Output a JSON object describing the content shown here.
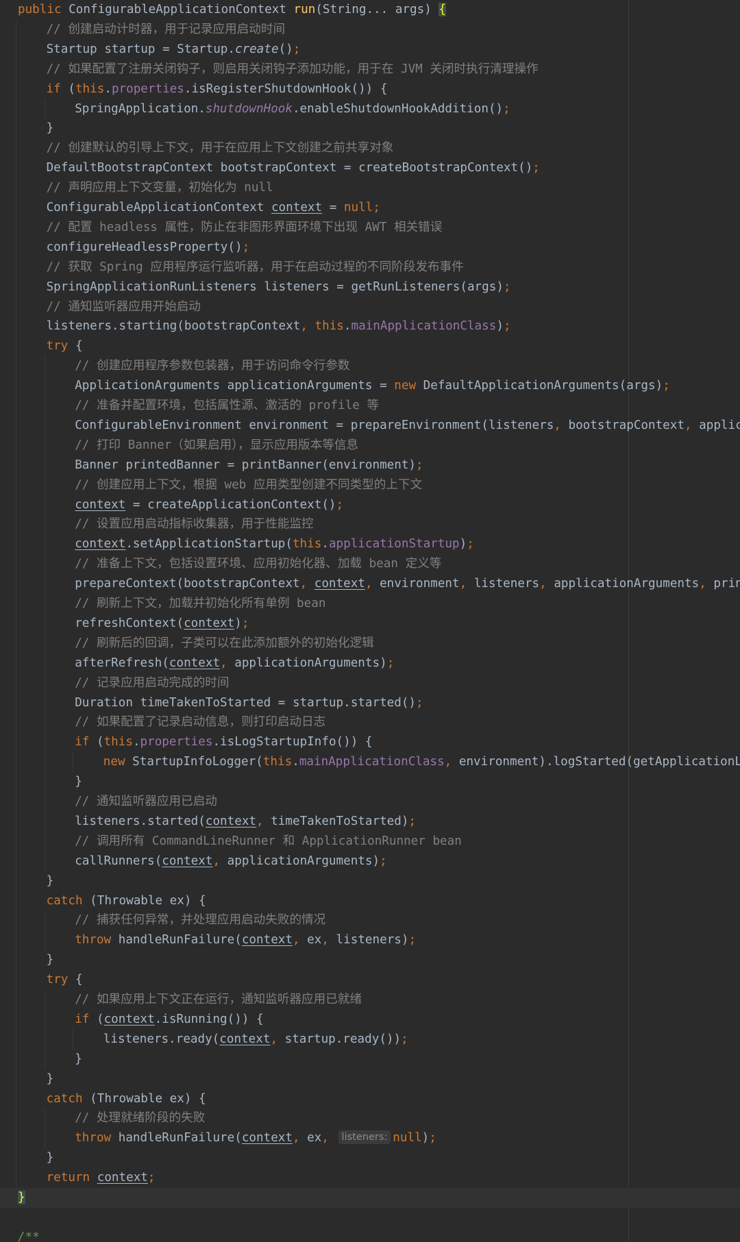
{
  "editor": {
    "language": "Java",
    "colors": {
      "background": "#2b2b2b",
      "default": "#a9b7c6",
      "keyword": "#cc7832",
      "method_declaration": "#ffc66d",
      "comment": "#808080",
      "field": "#9876aa",
      "doc_comment": "#629755",
      "brace_match": "#ffef28"
    },
    "lines": [
      {
        "indent": 0,
        "tokens": [
          {
            "t": "public ",
            "s": "kw"
          },
          {
            "t": "ConfigurableApplicationContext "
          },
          {
            "t": "run",
            "s": "fn"
          },
          {
            "t": "(String... args) "
          },
          {
            "t": "{",
            "s": "brace-hl"
          }
        ]
      },
      {
        "indent": 1,
        "tokens": [
          {
            "t": "// 创建启动计时器，用于记录应用启动时间",
            "s": "cm"
          }
        ]
      },
      {
        "indent": 1,
        "tokens": [
          {
            "t": "Startup startup = Startup."
          },
          {
            "t": "create",
            "s": "ital"
          },
          {
            "t": "()"
          },
          {
            "t": ";",
            "s": "kw"
          }
        ]
      },
      {
        "indent": 1,
        "tokens": [
          {
            "t": "// 如果配置了注册关闭钩子，则启用关闭钩子添加功能，用于在 JVM 关闭时执行清理操作",
            "s": "cm"
          }
        ]
      },
      {
        "indent": 1,
        "tokens": [
          {
            "t": "if ",
            "s": "kw"
          },
          {
            "t": "("
          },
          {
            "t": "this",
            "s": "kw"
          },
          {
            "t": "."
          },
          {
            "t": "properties",
            "s": "fld"
          },
          {
            "t": ".isRegisterShutdownHook()) {"
          }
        ]
      },
      {
        "indent": 2,
        "tokens": [
          {
            "t": "SpringApplication."
          },
          {
            "t": "shutdownHook",
            "s": "st"
          },
          {
            "t": ".enableShutdownHookAddition()"
          },
          {
            "t": ";",
            "s": "kw"
          }
        ]
      },
      {
        "indent": 1,
        "tokens": [
          {
            "t": "}"
          }
        ]
      },
      {
        "indent": 1,
        "tokens": [
          {
            "t": "// 创建默认的引导上下文，用于在应用上下文创建之前共享对象",
            "s": "cm"
          }
        ]
      },
      {
        "indent": 1,
        "tokens": [
          {
            "t": "DefaultBootstrapContext bootstrapContext = createBootstrapContext()"
          },
          {
            "t": ";",
            "s": "kw"
          }
        ]
      },
      {
        "indent": 1,
        "tokens": [
          {
            "t": "// 声明应用上下文变量，初始化为 null",
            "s": "cm"
          }
        ]
      },
      {
        "indent": 1,
        "tokens": [
          {
            "t": "ConfigurableApplicationContext "
          },
          {
            "t": "context",
            "s": "ul"
          },
          {
            "t": " = "
          },
          {
            "t": "null;",
            "s": "kw"
          }
        ]
      },
      {
        "indent": 1,
        "tokens": [
          {
            "t": "// 配置 headless 属性，防止在非图形界面环境下出现 AWT 相关错误",
            "s": "cm"
          }
        ]
      },
      {
        "indent": 1,
        "tokens": [
          {
            "t": "configureHeadlessProperty()"
          },
          {
            "t": ";",
            "s": "kw"
          }
        ]
      },
      {
        "indent": 1,
        "tokens": [
          {
            "t": "// 获取 Spring 应用程序运行监听器，用于在启动过程的不同阶段发布事件",
            "s": "cm"
          }
        ]
      },
      {
        "indent": 1,
        "tokens": [
          {
            "t": "SpringApplicationRunListeners listeners = getRunListeners(args)"
          },
          {
            "t": ";",
            "s": "kw"
          }
        ]
      },
      {
        "indent": 1,
        "tokens": [
          {
            "t": "// 通知监听器应用开始启动",
            "s": "cm"
          }
        ]
      },
      {
        "indent": 1,
        "tokens": [
          {
            "t": "listeners.starting(bootstrapContext"
          },
          {
            "t": ", ",
            "s": "kw"
          },
          {
            "t": "this",
            "s": "kw"
          },
          {
            "t": "."
          },
          {
            "t": "mainApplicationClass",
            "s": "fld"
          },
          {
            "t": ")"
          },
          {
            "t": ";",
            "s": "kw"
          }
        ]
      },
      {
        "indent": 1,
        "tokens": [
          {
            "t": "try ",
            "s": "kw"
          },
          {
            "t": "{"
          }
        ]
      },
      {
        "indent": 2,
        "tokens": [
          {
            "t": "// 创建应用程序参数包装器，用于访问命令行参数",
            "s": "cm"
          }
        ]
      },
      {
        "indent": 2,
        "tokens": [
          {
            "t": "ApplicationArguments applicationArguments = "
          },
          {
            "t": "new ",
            "s": "kw"
          },
          {
            "t": "DefaultApplicationArguments(args)"
          },
          {
            "t": ";",
            "s": "kw"
          }
        ]
      },
      {
        "indent": 2,
        "tokens": [
          {
            "t": "// 准备并配置环境，包括属性源、激活的 profile 等",
            "s": "cm"
          }
        ]
      },
      {
        "indent": 2,
        "tokens": [
          {
            "t": "ConfigurableEnvironment environment = prepareEnvironment(listeners"
          },
          {
            "t": ", ",
            "s": "kw"
          },
          {
            "t": "bootstrapContext"
          },
          {
            "t": ", ",
            "s": "kw"
          },
          {
            "t": "applicat"
          }
        ]
      },
      {
        "indent": 2,
        "tokens": [
          {
            "t": "// 打印 Banner（如果启用），显示应用版本等信息",
            "s": "cm"
          }
        ]
      },
      {
        "indent": 2,
        "tokens": [
          {
            "t": "Banner printedBanner = printBanner(environment)"
          },
          {
            "t": ";",
            "s": "kw"
          }
        ]
      },
      {
        "indent": 2,
        "tokens": [
          {
            "t": "// 创建应用上下文，根据 web 应用类型创建不同类型的上下文",
            "s": "cm"
          }
        ]
      },
      {
        "indent": 2,
        "tokens": [
          {
            "t": "context",
            "s": "ul"
          },
          {
            "t": " = createApplicationContext()"
          },
          {
            "t": ";",
            "s": "kw"
          }
        ]
      },
      {
        "indent": 2,
        "tokens": [
          {
            "t": "// 设置应用启动指标收集器，用于性能监控",
            "s": "cm"
          }
        ]
      },
      {
        "indent": 2,
        "tokens": [
          {
            "t": "context",
            "s": "ul"
          },
          {
            "t": ".setApplicationStartup("
          },
          {
            "t": "this",
            "s": "kw"
          },
          {
            "t": "."
          },
          {
            "t": "applicationStartup",
            "s": "fld"
          },
          {
            "t": ")"
          },
          {
            "t": ";",
            "s": "kw"
          }
        ]
      },
      {
        "indent": 2,
        "tokens": [
          {
            "t": "// 准备上下文，包括设置环境、应用初始化器、加载 bean 定义等",
            "s": "cm"
          }
        ]
      },
      {
        "indent": 2,
        "tokens": [
          {
            "t": "prepareContext(bootstrapContext"
          },
          {
            "t": ", ",
            "s": "kw"
          },
          {
            "t": "context",
            "s": "ul"
          },
          {
            "t": ", ",
            "s": "kw"
          },
          {
            "t": "environment"
          },
          {
            "t": ", ",
            "s": "kw"
          },
          {
            "t": "listeners"
          },
          {
            "t": ", ",
            "s": "kw"
          },
          {
            "t": "applicationArguments"
          },
          {
            "t": ", ",
            "s": "kw"
          },
          {
            "t": "printe"
          }
        ]
      },
      {
        "indent": 2,
        "tokens": [
          {
            "t": "// 刷新上下文，加载并初始化所有单例 bean",
            "s": "cm"
          }
        ]
      },
      {
        "indent": 2,
        "tokens": [
          {
            "t": "refreshContext("
          },
          {
            "t": "context",
            "s": "ul"
          },
          {
            "t": ")"
          },
          {
            "t": ";",
            "s": "kw"
          }
        ]
      },
      {
        "indent": 2,
        "tokens": [
          {
            "t": "// 刷新后的回调，子类可以在此添加额外的初始化逻辑",
            "s": "cm"
          }
        ]
      },
      {
        "indent": 2,
        "tokens": [
          {
            "t": "afterRefresh("
          },
          {
            "t": "context",
            "s": "ul"
          },
          {
            "t": ", ",
            "s": "kw"
          },
          {
            "t": "applicationArguments)"
          },
          {
            "t": ";",
            "s": "kw"
          }
        ]
      },
      {
        "indent": 2,
        "tokens": [
          {
            "t": "// 记录应用启动完成的时间",
            "s": "cm"
          }
        ]
      },
      {
        "indent": 2,
        "tokens": [
          {
            "t": "Duration timeTakenToStarted = startup.started()"
          },
          {
            "t": ";",
            "s": "kw"
          }
        ]
      },
      {
        "indent": 2,
        "tokens": [
          {
            "t": "// 如果配置了记录启动信息，则打印启动日志",
            "s": "cm"
          }
        ]
      },
      {
        "indent": 2,
        "tokens": [
          {
            "t": "if ",
            "s": "kw"
          },
          {
            "t": "("
          },
          {
            "t": "this",
            "s": "kw"
          },
          {
            "t": "."
          },
          {
            "t": "properties",
            "s": "fld"
          },
          {
            "t": ".isLogStartupInfo()) {"
          }
        ]
      },
      {
        "indent": 3,
        "tokens": [
          {
            "t": "new ",
            "s": "kw"
          },
          {
            "t": "StartupInfoLogger("
          },
          {
            "t": "this",
            "s": "kw"
          },
          {
            "t": "."
          },
          {
            "t": "mainApplicationClass",
            "s": "fld"
          },
          {
            "t": ", ",
            "s": "kw"
          },
          {
            "t": "environment).logStarted(getApplicationLog"
          }
        ]
      },
      {
        "indent": 2,
        "tokens": [
          {
            "t": "}"
          }
        ]
      },
      {
        "indent": 2,
        "tokens": [
          {
            "t": "// 通知监听器应用已启动",
            "s": "cm"
          }
        ]
      },
      {
        "indent": 2,
        "tokens": [
          {
            "t": "listeners.started("
          },
          {
            "t": "context",
            "s": "ul"
          },
          {
            "t": ", ",
            "s": "kw"
          },
          {
            "t": "timeTakenToStarted)"
          },
          {
            "t": ";",
            "s": "kw"
          }
        ]
      },
      {
        "indent": 2,
        "tokens": [
          {
            "t": "// 调用所有 CommandLineRunner 和 ApplicationRunner bean",
            "s": "cm"
          }
        ]
      },
      {
        "indent": 2,
        "tokens": [
          {
            "t": "callRunners("
          },
          {
            "t": "context",
            "s": "ul"
          },
          {
            "t": ", ",
            "s": "kw"
          },
          {
            "t": "applicationArguments)"
          },
          {
            "t": ";",
            "s": "kw"
          }
        ]
      },
      {
        "indent": 1,
        "tokens": [
          {
            "t": "}"
          }
        ]
      },
      {
        "indent": 1,
        "tokens": [
          {
            "t": "catch ",
            "s": "kw"
          },
          {
            "t": "(Throwable ex) {"
          }
        ]
      },
      {
        "indent": 2,
        "tokens": [
          {
            "t": "// 捕获任何异常，并处理应用启动失败的情况",
            "s": "cm"
          }
        ]
      },
      {
        "indent": 2,
        "tokens": [
          {
            "t": "throw ",
            "s": "kw"
          },
          {
            "t": "handleRunFailure("
          },
          {
            "t": "context",
            "s": "ul"
          },
          {
            "t": ", ",
            "s": "kw"
          },
          {
            "t": "ex"
          },
          {
            "t": ", ",
            "s": "kw"
          },
          {
            "t": "listeners)"
          },
          {
            "t": ";",
            "s": "kw"
          }
        ]
      },
      {
        "indent": 1,
        "tokens": [
          {
            "t": "}"
          }
        ]
      },
      {
        "indent": 1,
        "tokens": [
          {
            "t": "try ",
            "s": "kw"
          },
          {
            "t": "{"
          }
        ]
      },
      {
        "indent": 2,
        "tokens": [
          {
            "t": "// 如果应用上下文正在运行，通知监听器应用已就绪",
            "s": "cm"
          }
        ]
      },
      {
        "indent": 2,
        "tokens": [
          {
            "t": "if ",
            "s": "kw"
          },
          {
            "t": "("
          },
          {
            "t": "context",
            "s": "ul"
          },
          {
            "t": ".isRunning()) {"
          }
        ]
      },
      {
        "indent": 3,
        "tokens": [
          {
            "t": "listeners.ready("
          },
          {
            "t": "context",
            "s": "ul"
          },
          {
            "t": ", ",
            "s": "kw"
          },
          {
            "t": "startup.ready())"
          },
          {
            "t": ";",
            "s": "kw"
          }
        ]
      },
      {
        "indent": 2,
        "tokens": [
          {
            "t": "}"
          }
        ]
      },
      {
        "indent": 1,
        "tokens": [
          {
            "t": "}"
          }
        ]
      },
      {
        "indent": 1,
        "tokens": [
          {
            "t": "catch ",
            "s": "kw"
          },
          {
            "t": "(Throwable ex) {"
          }
        ]
      },
      {
        "indent": 2,
        "tokens": [
          {
            "t": "// 处理就绪阶段的失败",
            "s": "cm"
          }
        ]
      },
      {
        "indent": 2,
        "tokens": [
          {
            "t": "throw ",
            "s": "kw"
          },
          {
            "t": "handleRunFailure("
          },
          {
            "t": "context",
            "s": "ul"
          },
          {
            "t": ", ",
            "s": "kw"
          },
          {
            "t": "ex"
          },
          {
            "t": ", ",
            "s": "kw"
          },
          {
            "t": "listeners:",
            "s": "hint"
          },
          {
            "t": "null",
            "s": "kw"
          },
          {
            "t": ")"
          },
          {
            "t": ";",
            "s": "kw"
          }
        ]
      },
      {
        "indent": 1,
        "tokens": [
          {
            "t": "}"
          }
        ]
      },
      {
        "indent": 1,
        "tokens": [
          {
            "t": "return ",
            "s": "kw"
          },
          {
            "t": "context",
            "s": "ul"
          },
          {
            "t": ";",
            "s": "kw"
          }
        ]
      },
      {
        "indent": 0,
        "tokens": [
          {
            "t": "}",
            "s": "brace-hl2"
          }
        ],
        "current": true
      },
      {
        "indent": 0,
        "tokens": []
      },
      {
        "indent": 0,
        "tokens": [
          {
            "t": "/**",
            "s": "doc"
          }
        ]
      }
    ]
  }
}
